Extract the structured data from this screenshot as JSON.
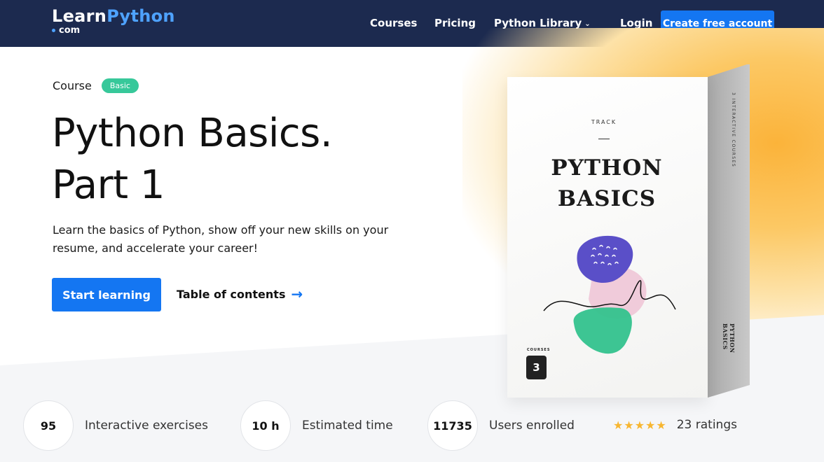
{
  "nav": {
    "logo_learn": "Learn",
    "logo_python": "Python",
    "logo_sub": "com",
    "links": [
      "Courses",
      "Pricing",
      "Python Library"
    ],
    "login": "Login",
    "cta": "Create free account",
    "chevron_icon": "chevron-down-icon"
  },
  "hero": {
    "course_label": "Course",
    "badge": "Basic",
    "title_line1": "Python Basics.",
    "title_line2": "Part 1",
    "description": "Learn the basics of Python, show off your new skills on your resume, and accelerate your career!",
    "start_button": "Start learning",
    "toc_link": "Table of contents",
    "toc_arrow": "→"
  },
  "box": {
    "track": "TRACK",
    "title_line1": "PYTHON",
    "title_line2": "BASICS",
    "side_top": "3 INTERACTIVE COURSES",
    "side_bottom": "PYTHON BASICS",
    "courses_label": "COURSES",
    "courses_count": "3",
    "colors": {
      "purple": "#5a4fc8",
      "pink": "#efc8d8",
      "green": "#33c28d"
    }
  },
  "stats": [
    {
      "value": "95",
      "label": "Interactive exercises"
    },
    {
      "value": "10 h",
      "label": "Estimated time"
    },
    {
      "value": "11735",
      "label": "Users enrolled"
    }
  ],
  "rating": {
    "stars": "★★★★★",
    "stars_value": 4.5,
    "stars_max": 5,
    "label": "23 ratings"
  },
  "colors": {
    "nav_bg": "#1c2a4f",
    "primary": "#1476f2",
    "badge_green": "#37c89a",
    "star": "#f7b631"
  }
}
